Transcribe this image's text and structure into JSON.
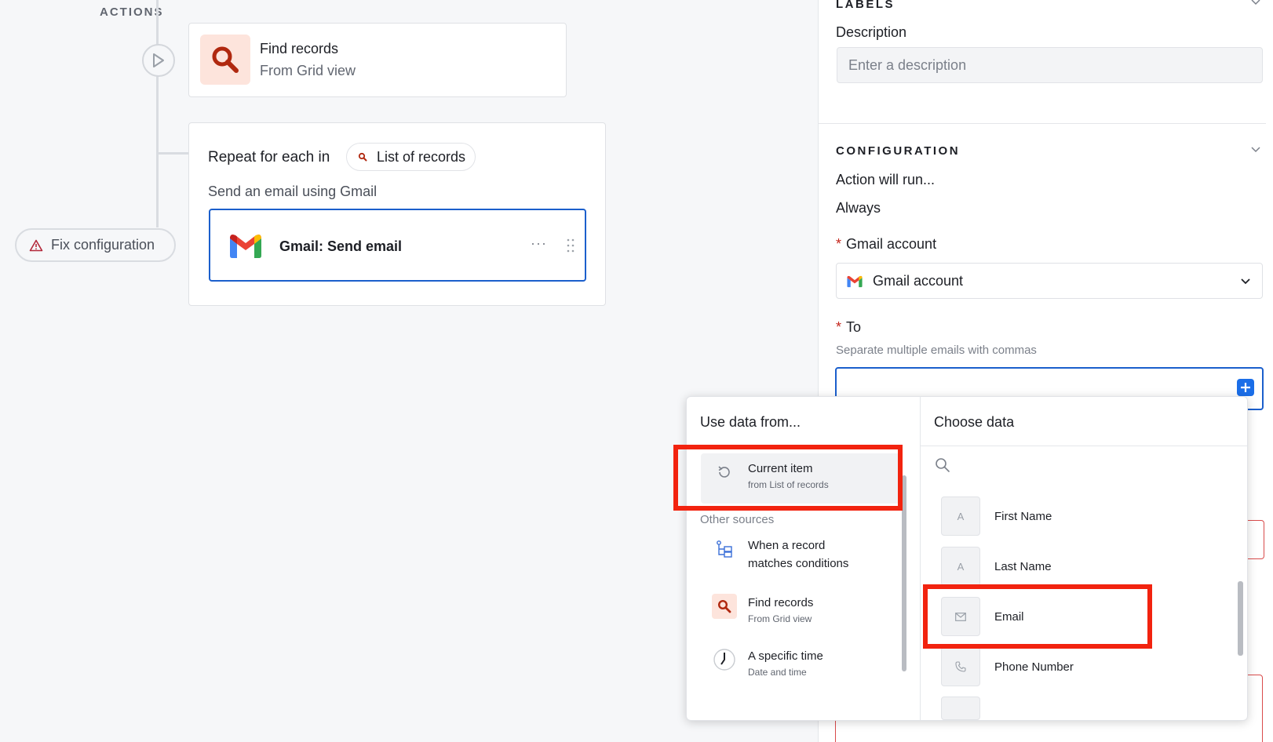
{
  "canvas": {
    "section_label": "ACTIONS",
    "find_card": {
      "title": "Find records",
      "subtitle": "From Grid view"
    },
    "repeat_card": {
      "title": "Repeat for each in",
      "pill_label": "List of records",
      "subtitle": "Send an email using Gmail",
      "action_label": "Gmail: Send email",
      "more_label": "···"
    },
    "fix_button_label": "Fix configuration"
  },
  "panel": {
    "labels_section": "LABELS",
    "description_label": "Description",
    "description_placeholder": "Enter a description",
    "configuration_section": "CONFIGURATION",
    "action_run_label": "Action will run...",
    "action_run_value": "Always",
    "required_mark": "*",
    "gmail_account_label": "Gmail account",
    "gmail_account_value": "Gmail account",
    "to_label": "To",
    "to_hint": "Separate multiple emails with commas"
  },
  "popover": {
    "left_header": "Use data from...",
    "right_header": "Choose data",
    "current_item": {
      "title": "Current item",
      "subtitle": "from List of records"
    },
    "other_sources_label": "Other sources",
    "sources": [
      {
        "title": "When a record",
        "title2": "matches conditions"
      },
      {
        "title": "Find records",
        "subtitle": "From Grid view"
      },
      {
        "title": "A specific time",
        "subtitle": "Date and time"
      }
    ],
    "fields": [
      {
        "label": "First Name",
        "icon": "A"
      },
      {
        "label": "Last Name",
        "icon": "A"
      },
      {
        "label": "Email",
        "icon": "envelope-icon"
      },
      {
        "label": "Phone Number",
        "icon": "phone-icon"
      }
    ]
  },
  "colors": {
    "accent_blue": "#1b5fcc",
    "highlight_red": "#f2230f",
    "find_icon_bg": "#fde4dc",
    "find_icon": "#b0280f"
  }
}
